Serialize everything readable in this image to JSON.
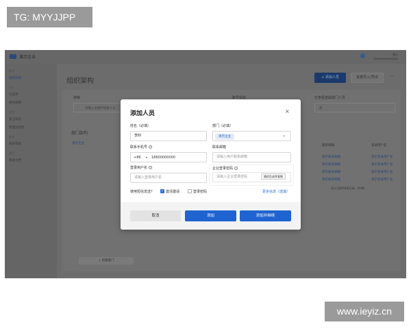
{
  "tags": {
    "top_left": "TG: MYYJJPP",
    "bottom_right": "www.ieyiz.cn"
  },
  "app": {
    "name": "演示企业",
    "user_line1": "演示",
    "user_line2": "xxxxxxxxxxxxxxx"
  },
  "sidebar": {
    "groups": [
      "首页",
      "员工",
      "应用",
      "安全",
      "其它"
    ],
    "items": [
      "组织架构",
      "认证源",
      "密码策略",
      "安全日志",
      "管理员角色",
      "系统审核",
      "帮助文档"
    ]
  },
  "main": {
    "title": "组织架构",
    "add_button": "+ 添加人员",
    "batch_button": "批量导入/导出",
    "more": "···",
    "search_label": "搜索",
    "search_placeholder": "请输入关键字搜索人员",
    "status_label": "账号状态",
    "filter_label": "仅查看直属部门人员",
    "filter_value": "否",
    "dept_title": "部门架构",
    "dept_item": "演示企业",
    "col_email": "联系邮箱",
    "col_login": "登录用户名",
    "cells_email": [
      "演示联系邮箱",
      "演示联系邮箱",
      "演示联系邮箱",
      "演示联系邮箱"
    ],
    "cells_login": [
      "演示登录用户名",
      "演示登录用户名",
      "演示登录用户名",
      "演示登录用户名"
    ],
    "pager": "显示当前的4条记录，共4条",
    "new_dept": "+ 新建部门"
  },
  "modal": {
    "title": "添加人员",
    "close": "×",
    "name_label": "姓名（必填）",
    "name_value": "李四",
    "dept_label": "部门（必填）",
    "dept_tag": "演示企业",
    "phone_label": "联系手机号",
    "phone_code": "+86",
    "phone_value": "18600000000",
    "email_label": "联系邮箱",
    "email_placeholder": "请输入用户联系邮箱",
    "login_label": "登录用户名",
    "login_placeholder": "请输入登录用户名",
    "pwd_label": "企业登录密码",
    "pwd_placeholder": "请输入企业登录密码",
    "gen_button": "随机生成并复制",
    "sms_label": "使用短信发送",
    "opt_invite": "激活邀请",
    "opt_pwd": "登录密码",
    "more_info": "更多信息（选填）",
    "cancel": "取消",
    "add": "添加",
    "add_continue": "添加并继续"
  }
}
